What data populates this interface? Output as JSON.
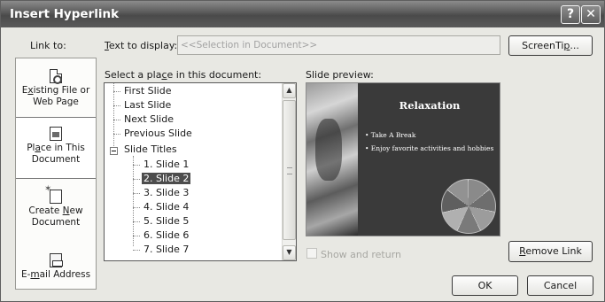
{
  "window": {
    "title": "Insert Hyperlink",
    "help_glyph": "?",
    "close_glyph": "✕"
  },
  "link_to": {
    "label": "Link to:",
    "items": [
      {
        "label_pre": "E",
        "label_u": "x",
        "label_post": "isting File or Web Page",
        "icon": "existing-file-icon",
        "selected": false
      },
      {
        "label_pre": "Pl",
        "label_u": "a",
        "label_post": "ce in This Document",
        "icon": "place-in-document-icon",
        "selected": true
      },
      {
        "label_pre": "Create ",
        "label_u": "N",
        "label_post": "ew Document",
        "icon": "new-document-icon",
        "selected": false
      },
      {
        "label_pre": "E-",
        "label_u": "m",
        "label_post": "ail Address",
        "icon": "email-address-icon",
        "selected": false
      }
    ]
  },
  "text_to_display": {
    "label_u": "T",
    "label_post": "ext to display:",
    "value": "<<Selection in Document>>"
  },
  "screentip_button": {
    "label_pre": "ScreenTi",
    "label_u": "p",
    "label_post": "..."
  },
  "select_place": {
    "label_pre": "Select a pla",
    "label_u": "c",
    "label_post": "e in this document:",
    "items": [
      {
        "label": "First Slide",
        "level": 0
      },
      {
        "label": "Last Slide",
        "level": 0
      },
      {
        "label": "Next Slide",
        "level": 0
      },
      {
        "label": "Previous Slide",
        "level": 0
      },
      {
        "label": "Slide Titles",
        "level": 0,
        "expanded": true
      },
      {
        "label": "1. Slide 1",
        "level": 1
      },
      {
        "label": "2. Slide 2",
        "level": 1,
        "selected": true
      },
      {
        "label": "3. Slide 3",
        "level": 1
      },
      {
        "label": "4. Slide 4",
        "level": 1
      },
      {
        "label": "5. Slide 5",
        "level": 1
      },
      {
        "label": "6. Slide 6",
        "level": 1
      },
      {
        "label": "7. Slide 7",
        "level": 1
      }
    ]
  },
  "preview": {
    "label": "Slide preview:",
    "slide_title": "Relaxation",
    "bullets": [
      "• Take A Break",
      "• Enjoy favorite activities and hobbies"
    ],
    "pie_slices": 7,
    "show_and_return": {
      "label": "Show and return",
      "checked": false,
      "enabled": false
    }
  },
  "remove_link_button": {
    "label_u": "R",
    "label_post": "emove Link"
  },
  "ok_button": {
    "label": "OK"
  },
  "cancel_button": {
    "label": "Cancel"
  },
  "colors": {
    "dialog_bg": "#e8e8e3",
    "titlebar": "#585858",
    "selection": "#4d4d4d",
    "pie": [
      "#8a8a8a",
      "#6e6e6e",
      "#9c9c9c",
      "#7a7a7a",
      "#b0b0b0",
      "#5f5f5f",
      "#929292"
    ]
  }
}
